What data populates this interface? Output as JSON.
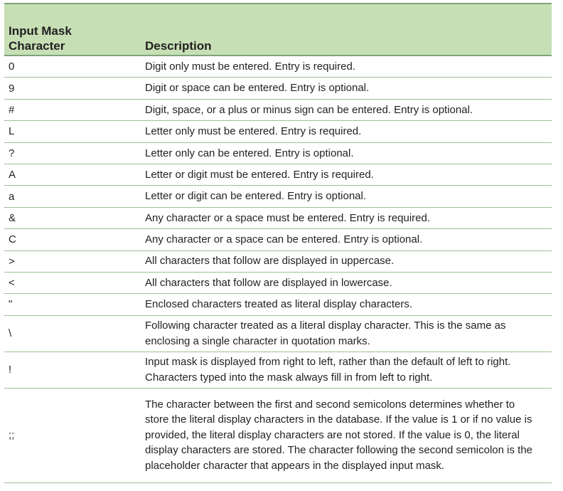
{
  "header": {
    "col1": "Input Mask Character",
    "col1_line1": "Input Mask",
    "col1_line2": "Character",
    "col2": "Description"
  },
  "rows": [
    {
      "char": "0",
      "desc": "Digit only must be entered. Entry is required."
    },
    {
      "char": "9",
      "desc": "Digit or space can be entered. Entry is optional."
    },
    {
      "char": "#",
      "desc": "Digit, space, or a plus or minus sign can be entered. Entry is optional."
    },
    {
      "char": "L",
      "desc": "Letter only must be entered. Entry is required."
    },
    {
      "char": "?",
      "desc": "Letter only can be entered. Entry is optional."
    },
    {
      "char": "A",
      "desc": "Letter or digit must be entered. Entry is required."
    },
    {
      "char": "a",
      "desc": "Letter or digit can be entered. Entry is optional."
    },
    {
      "char": "&",
      "desc": "Any character or a space must be entered. Entry is required."
    },
    {
      "char": "C",
      "desc": "Any character or a space can be entered. Entry is optional."
    },
    {
      "char": ">",
      "desc": "All characters that follow are displayed in uppercase."
    },
    {
      "char": "<",
      "desc": "All characters that follow are displayed in lowercase."
    },
    {
      "char": "\"",
      "desc": "Enclosed characters treated as literal display characters."
    },
    {
      "char": "\\",
      "desc": "Following character treated as a literal display character. This is the same as enclosing a single character in quotation marks."
    },
    {
      "char": "!",
      "desc": "Input mask is displayed from right to left, rather than the default of left to right. Characters typed into the mask always fill in from left to right."
    },
    {
      "char": ";;",
      "desc": "The character between the first and second semicolons determines whether to store the literal display characters in the database. If the value is 1 or if no value is provided, the literal display characters are not stored. If the value is 0, the literal display characters are stored. The character following the second semicolon is the placeholder character that appears in the displayed input mask."
    }
  ],
  "colors": {
    "header_bg": "#c6dfb5",
    "rule": "#7fa37a"
  }
}
